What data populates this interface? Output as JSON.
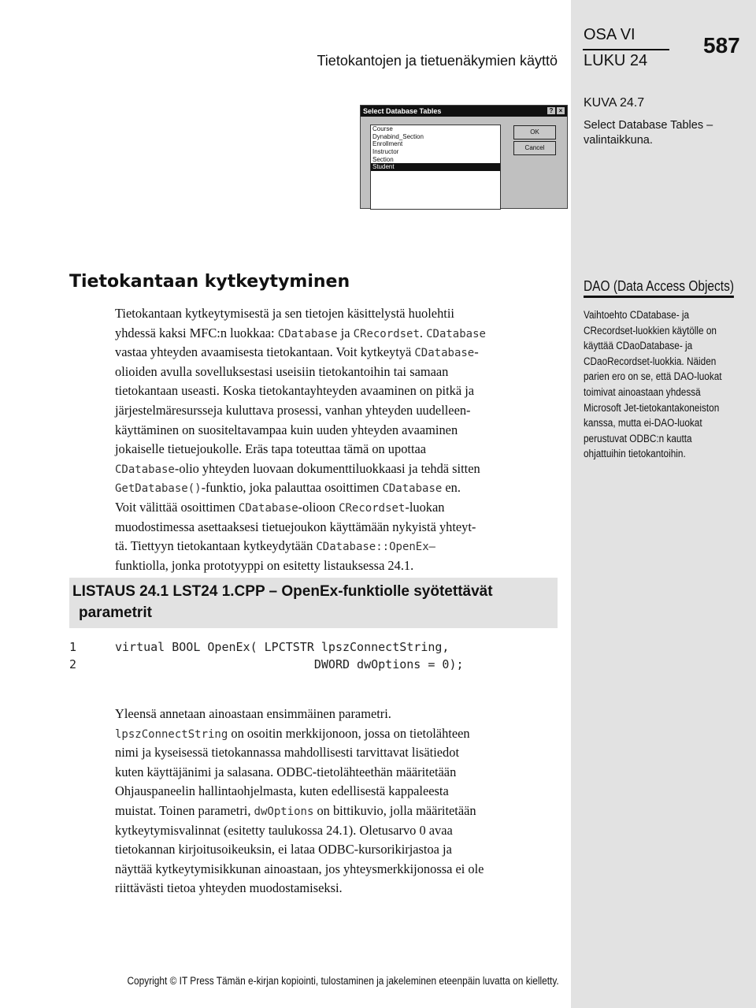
{
  "header": {
    "part": "OSA VI",
    "chapter": "LUKU 24",
    "page_number": "587",
    "running_title": "Tietokantojen ja tietuenäkymien käyttö"
  },
  "figure": {
    "label": "KUVA 24.7",
    "caption_lines": [
      "Select Database Tables –",
      "valintaikkuna."
    ],
    "dialog": {
      "title": "Select Database Tables",
      "help": "?",
      "close": "×",
      "items": [
        "Course",
        "Dynabind_Section",
        "Enrollment",
        "Instructor",
        "Section",
        "Student"
      ],
      "selected": "Student",
      "ok": "OK",
      "cancel": "Cancel"
    }
  },
  "section_title": "Tietokantaan kytkeytyminen",
  "paragraph1": [
    [
      {
        "t": "Tietokantaan kytkeytymisestä ja sen tietojen käsittelystä huolehtii"
      }
    ],
    [
      {
        "t": "yhdessä kaksi MFC:n luokkaa: "
      },
      {
        "c": "CDatabase"
      },
      {
        "t": " ja "
      },
      {
        "c": "CRecordset"
      },
      {
        "t": ". "
      },
      {
        "c": "CDatabase"
      }
    ],
    [
      {
        "t": "vastaa yhteyden avaamisesta tietokantaan. Voit kytkeytyä "
      },
      {
        "c": "CDatabase"
      },
      {
        "t": "-"
      }
    ],
    [
      {
        "t": "olioiden avulla sovelluksestasi useisiin tietokantoihin tai samaan"
      }
    ],
    [
      {
        "t": "tietokantaan useasti. Koska tietokantayhteyden avaaminen on pitkä ja"
      }
    ],
    [
      {
        "t": "järjestelmäresursseja kuluttava prosessi, vanhan yhteyden uudelleen-"
      }
    ],
    [
      {
        "t": "käyttäminen on suositeltavampaa kuin uuden yhteyden avaaminen"
      }
    ],
    [
      {
        "t": "jokaiselle tietuejoukolle. Eräs tapa toteuttaa tämä on upottaa"
      }
    ],
    [
      {
        "c": "CDatabase"
      },
      {
        "t": "-olio yhteyden luovaan dokumenttiluokkaasi ja tehdä sitten"
      }
    ],
    [
      {
        "c": "GetDatabase()"
      },
      {
        "t": "-funktio, joka palauttaa osoittimen "
      },
      {
        "c": "CDatabase"
      },
      {
        "t": " en."
      }
    ],
    [
      {
        "t": "Voit välittää osoittimen "
      },
      {
        "c": "CDatabase"
      },
      {
        "t": "-olioon "
      },
      {
        "c": "CRecordset"
      },
      {
        "t": "-luokan"
      }
    ],
    [
      {
        "t": "muodostimessa asettaaksesi tietuejoukon käyttämään nykyistä yhteyt-"
      }
    ],
    [
      {
        "t": "tä. Tiettyyn tietokantaan kytkeydytään "
      },
      {
        "c": "CDatabase::OpenEx"
      },
      {
        "t": "–"
      }
    ],
    [
      {
        "t": "funktiolla, jonka prototyyppi on esitetty listauksessa 24.1."
      }
    ]
  ],
  "listing": {
    "title_line1": "LISTAUS 24.1  LST24 1.CPP – OpenEx-funktiolle syötettävät",
    "title_line2": "parametrit",
    "lines": [
      {
        "n": "1",
        "code": "virtual BOOL OpenEx( LPCTSTR lpszConnectString,"
      },
      {
        "n": "2",
        "code": "                            DWORD dwOptions = 0);"
      }
    ]
  },
  "paragraph2": [
    [
      {
        "t": "Yleensä annetaan ainoastaan ensimmäinen parametri."
      }
    ],
    [
      {
        "c": "lpszConnectString"
      },
      {
        "t": " on osoitin merkkijonoon, jossa on tietolähteen"
      }
    ],
    [
      {
        "t": "nimi ja kyseisessä tietokannassa mahdollisesti tarvittavat lisätiedot"
      }
    ],
    [
      {
        "t": "kuten käyttäjänimi ja salasana. ODBC-tietolähteethän määritetään"
      }
    ],
    [
      {
        "t": "Ohjauspaneelin hallintaohjelmasta, kuten edellisestä kappaleesta"
      }
    ],
    [
      {
        "t": "muistat. Toinen parametri, "
      },
      {
        "c": "dwOptions"
      },
      {
        "t": " on bittikuvio, jolla määritetään"
      }
    ],
    [
      {
        "t": "kytkeytymisvalinnat (esitetty taulukossa 24.1). Oletusarvo 0 avaa"
      }
    ],
    [
      {
        "t": "tietokannan kirjoitusoikeuksin, ei lataa ODBC-kursorikirjastoa ja"
      }
    ],
    [
      {
        "t": "näyttää kytkeytymisikkunan ainoastaan, jos yhteysmerkkijonossa ei ole"
      }
    ],
    [
      {
        "t": "riittävästi tietoa yhteyden muodostamiseksi."
      }
    ]
  ],
  "sidebar": {
    "title": "DAO (Data Access Objects)",
    "lines": [
      "Vaihtoehto CDatabase- ja",
      "CRecordset-luokkien käytölle on",
      "käyttää CDaoDatabase- ja",
      "CDaoRecordset-luokkia. Näiden",
      "parien ero on se, että DAO-luokat",
      "toimivat ainoastaan yhdessä",
      "Microsoft Jet-tietokantakoneiston",
      "kanssa, mutta ei-DAO-luokat",
      "perustuvat ODBC:n kautta",
      "ohjattuihin tietokantoihin."
    ]
  },
  "footer": "Copyright © IT Press  Tämän e-kirjan kopiointi, tulostaminen ja jakeleminen eteenpäin luvatta on kielletty."
}
